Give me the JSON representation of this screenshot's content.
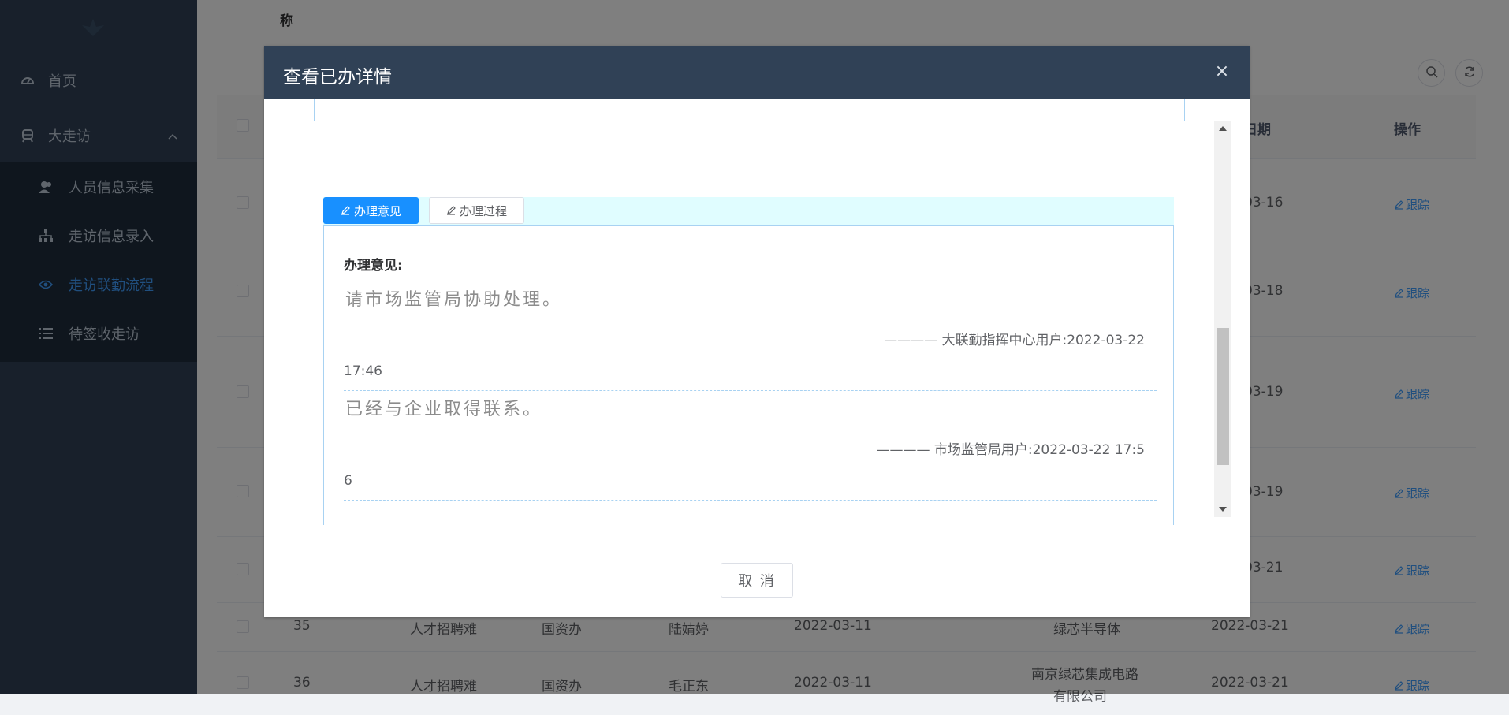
{
  "sidebar": {
    "items": [
      {
        "label": "首页",
        "icon": "dashboard-icon"
      },
      {
        "label": "大走访",
        "icon": "subway-icon"
      }
    ],
    "submenu": [
      {
        "label": "人员信息采集",
        "icon": "people-icon",
        "active": false
      },
      {
        "label": "走访信息录入",
        "icon": "tree-icon",
        "active": false
      },
      {
        "label": "走访联勤流程",
        "icon": "eye-icon",
        "active": true
      },
      {
        "label": "待签收走访",
        "icon": "list-icon",
        "active": false
      }
    ]
  },
  "main": {
    "column_title": "称",
    "headers": {
      "date_frag": "日期",
      "ops": "操作"
    },
    "rows": [
      {
        "date": "03-16",
        "action": "跟踪"
      },
      {
        "date": "03-18",
        "action": "跟踪"
      },
      {
        "date": "03-19",
        "action": "跟踪"
      },
      {
        "date": "03-19",
        "action": "跟踪"
      },
      {
        "date": "03-21",
        "action": "跟踪"
      },
      {
        "id": "35",
        "problem": "人才招聘难",
        "dept": "国资办",
        "person": "陆婧婷",
        "visit_date": "2022-03-11",
        "company": "绿芯半导体",
        "date": "2022-03-21",
        "action": "跟踪"
      },
      {
        "id": "36",
        "problem": "人才招聘难",
        "dept": "国资办",
        "person": "毛正东",
        "visit_date": "2022-03-11",
        "company_line1": "南京绿芯集成电路",
        "company_line2": "有限公司",
        "date": "2022-03-21",
        "action": "跟踪"
      }
    ]
  },
  "dialog": {
    "title": "查看已办详情",
    "close": "×",
    "tabs": [
      {
        "label": "办理意见",
        "active": true
      },
      {
        "label": "办理过程",
        "active": false
      }
    ],
    "opinion_label": "办理意见:",
    "opinions": [
      {
        "text": "请市场监管局协助处理。",
        "sign": "———— 大联勤指挥中心用户:2022-03-22",
        "tail": "17:46"
      },
      {
        "text": "已经与企业取得联系。",
        "sign": "———— 市场监管局用户:2022-03-22 17:5",
        "tail": "6"
      }
    ],
    "cancel_label": "取 消"
  },
  "colors": {
    "sidebar_bg": "#304156",
    "submenu_bg": "#1f2d3d",
    "accent": "#409eff",
    "tab_active": "#1890ff",
    "dialog_header": "#304156"
  }
}
